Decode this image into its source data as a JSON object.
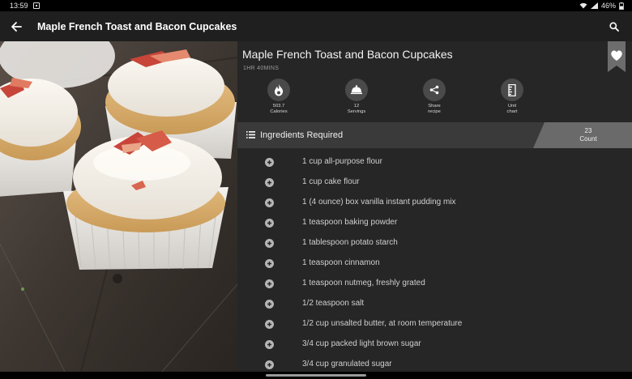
{
  "status_bar": {
    "time": "13:59",
    "battery": "46%",
    "icons": [
      "notification-icon",
      "wifi-icon",
      "signal-icon",
      "battery-icon"
    ]
  },
  "app_bar": {
    "title": "Maple French Toast and Bacon Cupcakes",
    "back_icon": "arrow-left-icon",
    "search_icon": "search-icon"
  },
  "hero": {
    "icon": "cupcake-photo"
  },
  "recipe": {
    "title": "Maple French Toast and Bacon Cupcakes",
    "time": "1HR 40MINS",
    "favorite_icon": "heart-icon"
  },
  "stats": [
    {
      "icon": "flame-icon",
      "line1": "503.7",
      "line2": "Calories"
    },
    {
      "icon": "cloche-icon",
      "line1": "12",
      "line2": "Servings"
    },
    {
      "icon": "share-icon",
      "line1": "Share",
      "line2": "recipe"
    },
    {
      "icon": "ruler-icon",
      "line1": "Unit",
      "line2": "chart"
    }
  ],
  "ingredients": {
    "header_icon": "list-icon",
    "header_label": "Ingredients Required",
    "count": "23",
    "count_label": "Count",
    "items": [
      "1 cup all-purpose flour",
      "1 cup cake flour",
      "1 (4 ounce) box vanilla instant pudding mix",
      "1 teaspoon baking powder",
      "1 tablespoon potato starch",
      "1 teaspoon cinnamon",
      "1 teaspoon nutmeg, freshly grated",
      "1/2 teaspoon salt",
      "1/2 cup unsalted butter, at room temperature",
      "3/4 cup packed light brown sugar",
      "3/4 cup granulated sugar"
    ]
  },
  "colors": {
    "background": "#000000",
    "app_bar": "#1f1f1f",
    "panel": "#262626",
    "header_band": "#3a3a3a",
    "count_box": "#6a6a6a"
  }
}
